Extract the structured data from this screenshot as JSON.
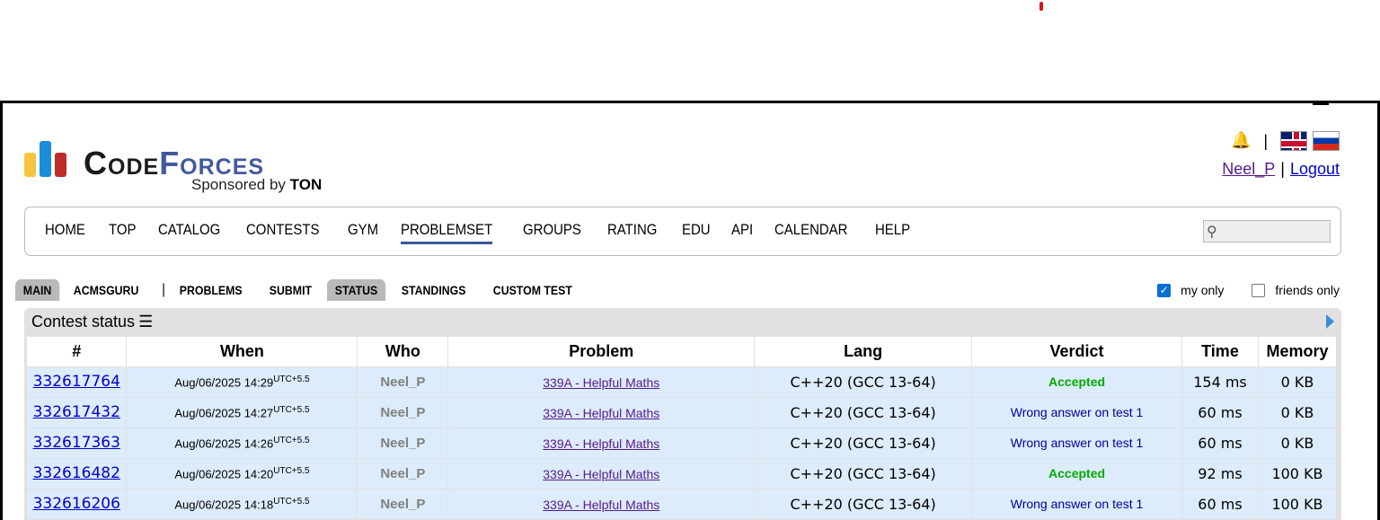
{
  "brand": {
    "word_code": "Code",
    "word_forces": "Forces",
    "sponsor_prefix": "Sponsored by ",
    "sponsor_name": "TON",
    "colors": {
      "yellow": "#f6c43e",
      "blue": "#1a8cd8",
      "red": "#bf2b2b",
      "forces": "#43599e"
    }
  },
  "header": {
    "separator": "|",
    "username": "Neel_P",
    "user_separator": "|",
    "logout": "Logout",
    "flags": [
      "english-flag",
      "russian-flag"
    ]
  },
  "menu": {
    "items": [
      "HOME",
      "TOP",
      "CATALOG",
      "CONTESTS",
      "GYM",
      "PROBLEMSET",
      "GROUPS",
      "RATING",
      "EDU",
      "API",
      "CALENDAR",
      "HELP"
    ],
    "active": "PROBLEMSET",
    "search_placeholder": ""
  },
  "subnav": {
    "items": [
      "MAIN",
      "ACMSGURU",
      "|",
      "PROBLEMS",
      "SUBMIT",
      "STATUS",
      "STANDINGS",
      "CUSTOM TEST"
    ]
  },
  "filters": {
    "my_only": "my only",
    "my_only_checked": true,
    "friends_only": "friends only",
    "friends_only_checked": false
  },
  "status": {
    "title": "Contest status",
    "columns": [
      "#",
      "When",
      "Who",
      "Problem",
      "Lang",
      "Verdict",
      "Time",
      "Memory"
    ],
    "rows": [
      {
        "id": "332617764",
        "when": "Aug/06/2025 14:29",
        "tz": "UTC+5.5",
        "who": "Neel_P",
        "problem": "339A - Helpful Maths",
        "lang": "C++20 (GCC 13-64)",
        "verdict": "Accepted",
        "time": "154 ms",
        "memory": "0 KB"
      },
      {
        "id": "332617432",
        "when": "Aug/06/2025 14:27",
        "tz": "UTC+5.5",
        "who": "Neel_P",
        "problem": "339A - Helpful Maths",
        "lang": "C++20 (GCC 13-64)",
        "verdict": "Wrong answer on test 1",
        "time": "60 ms",
        "memory": "0 KB"
      },
      {
        "id": "332617363",
        "when": "Aug/06/2025 14:26",
        "tz": "UTC+5.5",
        "who": "Neel_P",
        "problem": "339A - Helpful Maths",
        "lang": "C++20 (GCC 13-64)",
        "verdict": "Wrong answer on test 1",
        "time": "60 ms",
        "memory": "0 KB"
      },
      {
        "id": "332616482",
        "when": "Aug/06/2025 14:20",
        "tz": "UTC+5.5",
        "who": "Neel_P",
        "problem": "339A - Helpful Maths",
        "lang": "C++20 (GCC 13-64)",
        "verdict": "Accepted",
        "time": "92 ms",
        "memory": "100 KB"
      },
      {
        "id": "332616206",
        "when": "Aug/06/2025 14:18",
        "tz": "UTC+5.5",
        "who": "Neel_P",
        "problem": "339A - Helpful Maths",
        "lang": "C++20 (GCC 13-64)",
        "verdict": "Wrong answer on test 1",
        "time": "60 ms",
        "memory": "100 KB"
      }
    ]
  }
}
